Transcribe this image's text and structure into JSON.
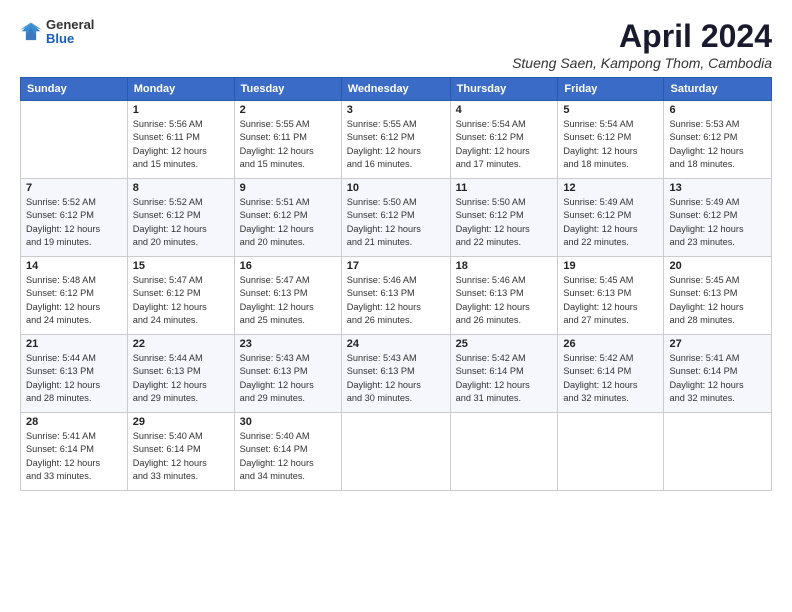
{
  "logo": {
    "general": "General",
    "blue": "Blue"
  },
  "title": "April 2024",
  "location": "Stueng Saen, Kampong Thom, Cambodia",
  "headers": [
    "Sunday",
    "Monday",
    "Tuesday",
    "Wednesday",
    "Thursday",
    "Friday",
    "Saturday"
  ],
  "weeks": [
    [
      {
        "day": "",
        "info": ""
      },
      {
        "day": "1",
        "info": "Sunrise: 5:56 AM\nSunset: 6:11 PM\nDaylight: 12 hours\nand 15 minutes."
      },
      {
        "day": "2",
        "info": "Sunrise: 5:55 AM\nSunset: 6:11 PM\nDaylight: 12 hours\nand 15 minutes."
      },
      {
        "day": "3",
        "info": "Sunrise: 5:55 AM\nSunset: 6:12 PM\nDaylight: 12 hours\nand 16 minutes."
      },
      {
        "day": "4",
        "info": "Sunrise: 5:54 AM\nSunset: 6:12 PM\nDaylight: 12 hours\nand 17 minutes."
      },
      {
        "day": "5",
        "info": "Sunrise: 5:54 AM\nSunset: 6:12 PM\nDaylight: 12 hours\nand 18 minutes."
      },
      {
        "day": "6",
        "info": "Sunrise: 5:53 AM\nSunset: 6:12 PM\nDaylight: 12 hours\nand 18 minutes."
      }
    ],
    [
      {
        "day": "7",
        "info": "Sunrise: 5:52 AM\nSunset: 6:12 PM\nDaylight: 12 hours\nand 19 minutes."
      },
      {
        "day": "8",
        "info": "Sunrise: 5:52 AM\nSunset: 6:12 PM\nDaylight: 12 hours\nand 20 minutes."
      },
      {
        "day": "9",
        "info": "Sunrise: 5:51 AM\nSunset: 6:12 PM\nDaylight: 12 hours\nand 20 minutes."
      },
      {
        "day": "10",
        "info": "Sunrise: 5:50 AM\nSunset: 6:12 PM\nDaylight: 12 hours\nand 21 minutes."
      },
      {
        "day": "11",
        "info": "Sunrise: 5:50 AM\nSunset: 6:12 PM\nDaylight: 12 hours\nand 22 minutes."
      },
      {
        "day": "12",
        "info": "Sunrise: 5:49 AM\nSunset: 6:12 PM\nDaylight: 12 hours\nand 22 minutes."
      },
      {
        "day": "13",
        "info": "Sunrise: 5:49 AM\nSunset: 6:12 PM\nDaylight: 12 hours\nand 23 minutes."
      }
    ],
    [
      {
        "day": "14",
        "info": "Sunrise: 5:48 AM\nSunset: 6:12 PM\nDaylight: 12 hours\nand 24 minutes."
      },
      {
        "day": "15",
        "info": "Sunrise: 5:47 AM\nSunset: 6:12 PM\nDaylight: 12 hours\nand 24 minutes."
      },
      {
        "day": "16",
        "info": "Sunrise: 5:47 AM\nSunset: 6:13 PM\nDaylight: 12 hours\nand 25 minutes."
      },
      {
        "day": "17",
        "info": "Sunrise: 5:46 AM\nSunset: 6:13 PM\nDaylight: 12 hours\nand 26 minutes."
      },
      {
        "day": "18",
        "info": "Sunrise: 5:46 AM\nSunset: 6:13 PM\nDaylight: 12 hours\nand 26 minutes."
      },
      {
        "day": "19",
        "info": "Sunrise: 5:45 AM\nSunset: 6:13 PM\nDaylight: 12 hours\nand 27 minutes."
      },
      {
        "day": "20",
        "info": "Sunrise: 5:45 AM\nSunset: 6:13 PM\nDaylight: 12 hours\nand 28 minutes."
      }
    ],
    [
      {
        "day": "21",
        "info": "Sunrise: 5:44 AM\nSunset: 6:13 PM\nDaylight: 12 hours\nand 28 minutes."
      },
      {
        "day": "22",
        "info": "Sunrise: 5:44 AM\nSunset: 6:13 PM\nDaylight: 12 hours\nand 29 minutes."
      },
      {
        "day": "23",
        "info": "Sunrise: 5:43 AM\nSunset: 6:13 PM\nDaylight: 12 hours\nand 29 minutes."
      },
      {
        "day": "24",
        "info": "Sunrise: 5:43 AM\nSunset: 6:13 PM\nDaylight: 12 hours\nand 30 minutes."
      },
      {
        "day": "25",
        "info": "Sunrise: 5:42 AM\nSunset: 6:14 PM\nDaylight: 12 hours\nand 31 minutes."
      },
      {
        "day": "26",
        "info": "Sunrise: 5:42 AM\nSunset: 6:14 PM\nDaylight: 12 hours\nand 32 minutes."
      },
      {
        "day": "27",
        "info": "Sunrise: 5:41 AM\nSunset: 6:14 PM\nDaylight: 12 hours\nand 32 minutes."
      }
    ],
    [
      {
        "day": "28",
        "info": "Sunrise: 5:41 AM\nSunset: 6:14 PM\nDaylight: 12 hours\nand 33 minutes."
      },
      {
        "day": "29",
        "info": "Sunrise: 5:40 AM\nSunset: 6:14 PM\nDaylight: 12 hours\nand 33 minutes."
      },
      {
        "day": "30",
        "info": "Sunrise: 5:40 AM\nSunset: 6:14 PM\nDaylight: 12 hours\nand 34 minutes."
      },
      {
        "day": "",
        "info": ""
      },
      {
        "day": "",
        "info": ""
      },
      {
        "day": "",
        "info": ""
      },
      {
        "day": "",
        "info": ""
      }
    ]
  ]
}
